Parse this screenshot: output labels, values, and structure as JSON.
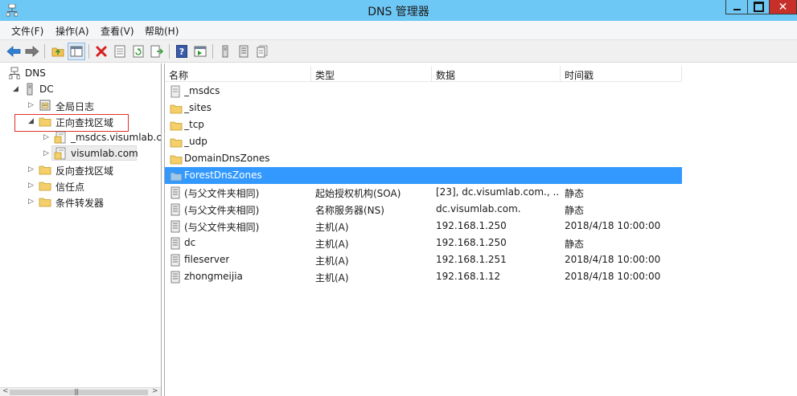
{
  "window": {
    "title": "DNS 管理器",
    "close_glyph": "✕"
  },
  "menu": [
    "文件(F)",
    "操作(A)",
    "查看(V)",
    "帮助(H)"
  ],
  "tree": {
    "root": "DNS",
    "server": "DC",
    "nodes": [
      "全局日志",
      "正向查找区域",
      "_msdcs.visumlab.cc",
      "visumlab.com",
      "反向查找区域",
      "信任点",
      "条件转发器"
    ]
  },
  "columns": [
    "名称",
    "类型",
    "数据",
    "时间戳"
  ],
  "rows": [
    {
      "name": "_msdcs",
      "type": "",
      "data": "",
      "timestamp": "",
      "icon": "zone-icon"
    },
    {
      "name": "_sites",
      "type": "",
      "data": "",
      "timestamp": "",
      "icon": "folder-icon"
    },
    {
      "name": "_tcp",
      "type": "",
      "data": "",
      "timestamp": "",
      "icon": "folder-icon"
    },
    {
      "name": "_udp",
      "type": "",
      "data": "",
      "timestamp": "",
      "icon": "folder-icon"
    },
    {
      "name": "DomainDnsZones",
      "type": "",
      "data": "",
      "timestamp": "",
      "icon": "folder-icon"
    },
    {
      "name": "ForestDnsZones",
      "type": "",
      "data": "",
      "timestamp": "",
      "icon": "folder-icon"
    },
    {
      "name": "(与父文件夹相同)",
      "type": "起始授权机构(SOA)",
      "data": "[23], dc.visumlab.com., ...",
      "timestamp": "静态",
      "icon": "record-icon"
    },
    {
      "name": "(与父文件夹相同)",
      "type": "名称服务器(NS)",
      "data": "dc.visumlab.com.",
      "timestamp": "静态",
      "icon": "record-icon"
    },
    {
      "name": "(与父文件夹相同)",
      "type": "主机(A)",
      "data": "192.168.1.250",
      "timestamp": "2018/4/18 10:00:00",
      "icon": "record-icon"
    },
    {
      "name": "dc",
      "type": "主机(A)",
      "data": "192.168.1.250",
      "timestamp": "静态",
      "icon": "record-icon"
    },
    {
      "name": "fileserver",
      "type": "主机(A)",
      "data": "192.168.1.251",
      "timestamp": "2018/4/18 10:00:00",
      "icon": "record-icon"
    },
    {
      "name": "zhongmeijia",
      "type": "主机(A)",
      "data": "192.168.1.12",
      "timestamp": "2018/4/18 10:00:00",
      "icon": "record-icon"
    }
  ],
  "selected_row": "ForestDnsZones",
  "colors": {
    "titlebar": "#6ec8f5",
    "selection": "#3399ff",
    "highlight_box": "#e0302a",
    "close": "#c7302a"
  }
}
